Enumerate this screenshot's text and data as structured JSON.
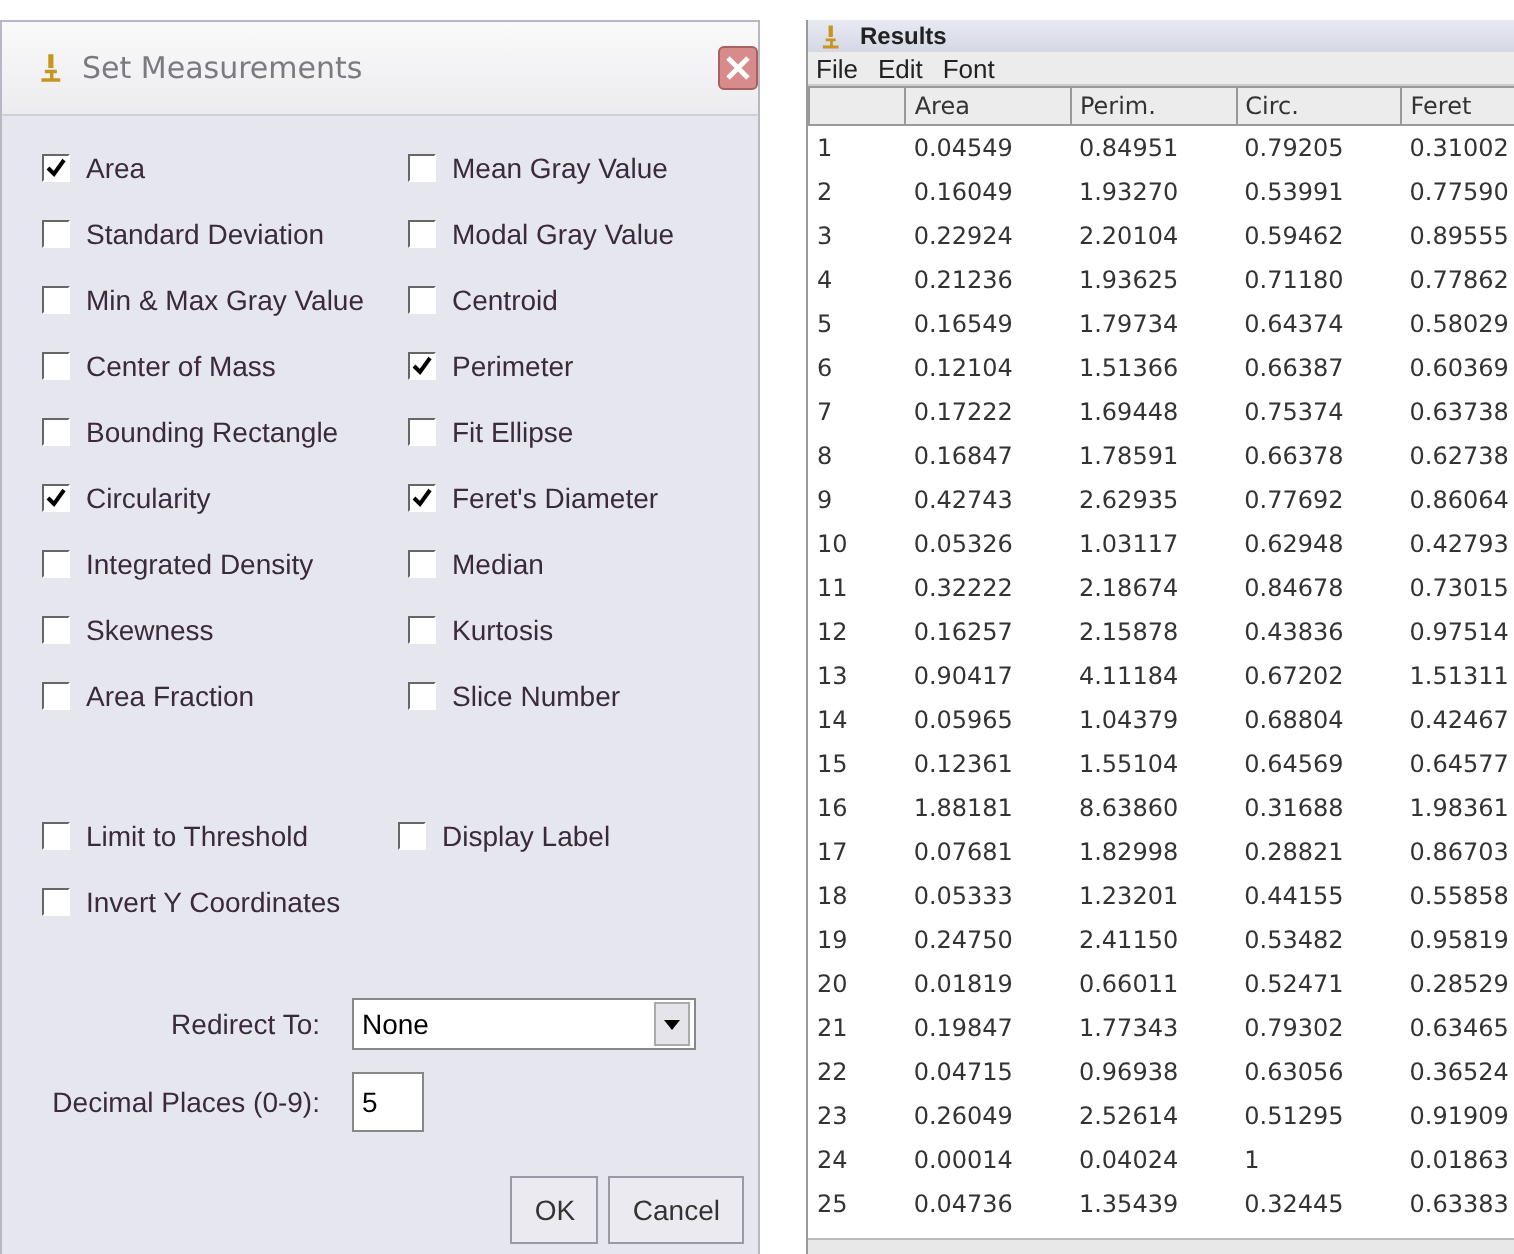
{
  "dialog": {
    "title": "Set Measurements",
    "checkboxes": [
      {
        "label": "Area",
        "checked": true
      },
      {
        "label": "Mean Gray Value",
        "checked": false
      },
      {
        "label": "Standard Deviation",
        "checked": false
      },
      {
        "label": "Modal Gray Value",
        "checked": false
      },
      {
        "label": "Min & Max Gray Value",
        "checked": false
      },
      {
        "label": "Centroid",
        "checked": false
      },
      {
        "label": "Center of Mass",
        "checked": false
      },
      {
        "label": "Perimeter",
        "checked": true
      },
      {
        "label": "Bounding Rectangle",
        "checked": false
      },
      {
        "label": "Fit Ellipse",
        "checked": false
      },
      {
        "label": "Circularity",
        "checked": true
      },
      {
        "label": "Feret's Diameter",
        "checked": true
      },
      {
        "label": "Integrated Density",
        "checked": false
      },
      {
        "label": "Median",
        "checked": false
      },
      {
        "label": "Skewness",
        "checked": false
      },
      {
        "label": "Kurtosis",
        "checked": false
      },
      {
        "label": "Area Fraction",
        "checked": false
      },
      {
        "label": "Slice Number",
        "checked": false
      }
    ],
    "options": [
      {
        "label": "Limit to Threshold",
        "checked": false
      },
      {
        "label": "Display Label",
        "checked": false
      },
      {
        "label": "Invert Y Coordinates",
        "checked": false
      }
    ],
    "redirect": {
      "label": "Redirect To:",
      "value": "None"
    },
    "decimal": {
      "label": "Decimal Places (0-9):",
      "value": "5"
    },
    "buttons": [
      "OK",
      "Cancel"
    ]
  },
  "results": {
    "title": "Results",
    "menu": [
      "File",
      "Edit",
      "Font"
    ],
    "columns": [
      "",
      "Area",
      "Perim.",
      "Circ.",
      "Feret"
    ],
    "rows": [
      [
        "1",
        "0.04549",
        "0.84951",
        "0.79205",
        "0.31002"
      ],
      [
        "2",
        "0.16049",
        "1.93270",
        "0.53991",
        "0.77590"
      ],
      [
        "3",
        "0.22924",
        "2.20104",
        "0.59462",
        "0.89555"
      ],
      [
        "4",
        "0.21236",
        "1.93625",
        "0.71180",
        "0.77862"
      ],
      [
        "5",
        "0.16549",
        "1.79734",
        "0.64374",
        "0.58029"
      ],
      [
        "6",
        "0.12104",
        "1.51366",
        "0.66387",
        "0.60369"
      ],
      [
        "7",
        "0.17222",
        "1.69448",
        "0.75374",
        "0.63738"
      ],
      [
        "8",
        "0.16847",
        "1.78591",
        "0.66378",
        "0.62738"
      ],
      [
        "9",
        "0.42743",
        "2.62935",
        "0.77692",
        "0.86064"
      ],
      [
        "10",
        "0.05326",
        "1.03117",
        "0.62948",
        "0.42793"
      ],
      [
        "11",
        "0.32222",
        "2.18674",
        "0.84678",
        "0.73015"
      ],
      [
        "12",
        "0.16257",
        "2.15878",
        "0.43836",
        "0.97514"
      ],
      [
        "13",
        "0.90417",
        "4.11184",
        "0.67202",
        "1.51311"
      ],
      [
        "14",
        "0.05965",
        "1.04379",
        "0.68804",
        "0.42467"
      ],
      [
        "15",
        "0.12361",
        "1.55104",
        "0.64569",
        "0.64577"
      ],
      [
        "16",
        "1.88181",
        "8.63860",
        "0.31688",
        "1.98361"
      ],
      [
        "17",
        "0.07681",
        "1.82998",
        "0.28821",
        "0.86703"
      ],
      [
        "18",
        "0.05333",
        "1.23201",
        "0.44155",
        "0.55858"
      ],
      [
        "19",
        "0.24750",
        "2.41150",
        "0.53482",
        "0.95819"
      ],
      [
        "20",
        "0.01819",
        "0.66011",
        "0.52471",
        "0.28529"
      ],
      [
        "21",
        "0.19847",
        "1.77343",
        "0.79302",
        "0.63465"
      ],
      [
        "22",
        "0.04715",
        "0.96938",
        "0.63056",
        "0.36524"
      ],
      [
        "23",
        "0.26049",
        "2.52614",
        "0.51295",
        "0.91909"
      ],
      [
        "24",
        "0.00014",
        "0.04024",
        "1",
        "0.01863"
      ],
      [
        "25",
        "0.04736",
        "1.35439",
        "0.32445",
        "0.63383"
      ]
    ]
  }
}
